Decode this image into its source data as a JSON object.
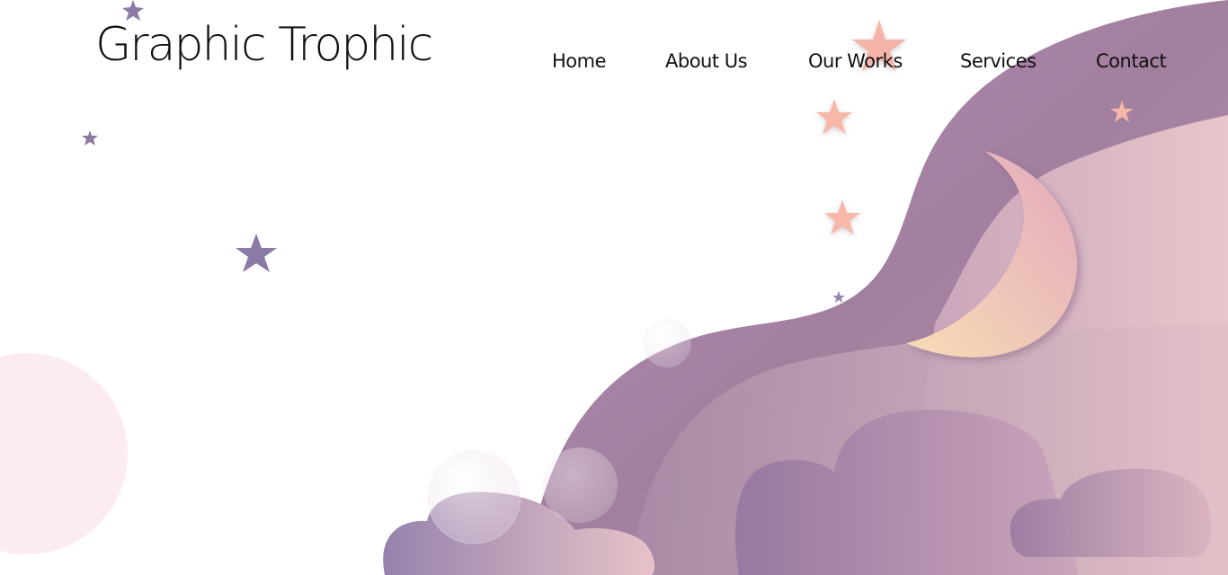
{
  "site": {
    "logo_text": "Graphic Trophic"
  },
  "nav": {
    "items": [
      {
        "label": "Home"
      },
      {
        "label": "About Us"
      },
      {
        "label": "Our Works"
      },
      {
        "label": "Services"
      },
      {
        "label": "Contact"
      }
    ]
  },
  "colors": {
    "background": "#ffffff",
    "text": "#111111",
    "hill_purple": "#a987ab",
    "hill_pink": "#ddbec6",
    "moon_peach": "#f3cdb7",
    "star_purple": "#8b7aa6",
    "star_peach": "#f7b6a8",
    "cloud_purple": "#9a84ad",
    "bubble_pink": "#fbe9ec"
  },
  "hero": {
    "illustration": [
      "moon-icon",
      "star-icon",
      "cloud-icon",
      "bubble-icon"
    ]
  }
}
